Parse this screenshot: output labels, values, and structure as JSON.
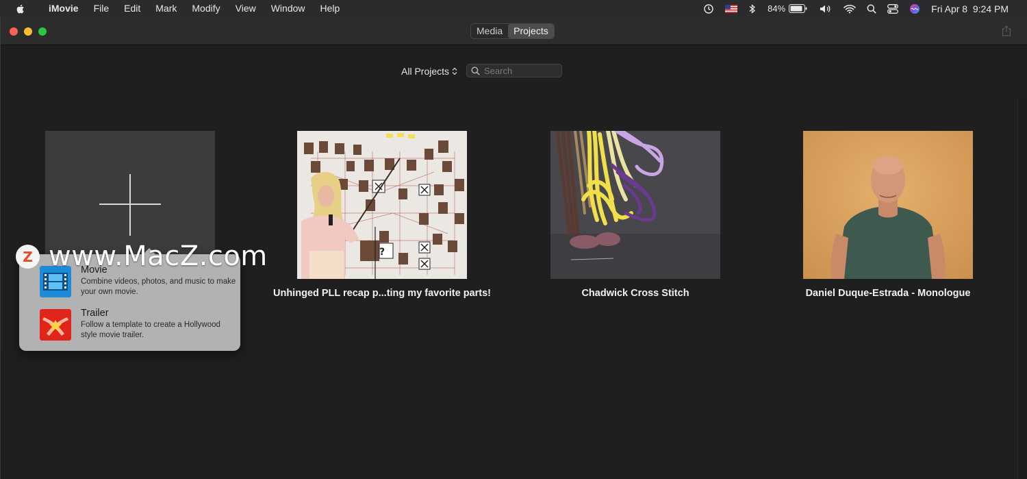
{
  "menubar": {
    "app_name": "iMovie",
    "menus": [
      "File",
      "Edit",
      "Mark",
      "Modify",
      "View",
      "Window",
      "Help"
    ],
    "battery": "84%",
    "datetime": "Fri Apr 8  9:24 PM"
  },
  "toolbar": {
    "tabs": [
      {
        "label": "Media",
        "active": false
      },
      {
        "label": "Projects",
        "active": true
      }
    ]
  },
  "browser": {
    "filter_label": "All Projects",
    "search_placeholder": "Search"
  },
  "projects": [
    {
      "title": "Unhinged PLL recap p...ting my favorite parts!"
    },
    {
      "title": "Chadwick Cross Stitch"
    },
    {
      "title": "Daniel Duque-Estrada - Monologue"
    }
  ],
  "new_project_menu": {
    "options": [
      {
        "title": "Movie",
        "description": "Combine videos, photos, and music to make your own movie."
      },
      {
        "title": "Trailer",
        "description": "Follow a template to create a Hollywood style movie trailer."
      }
    ]
  },
  "watermark": {
    "badge": "Z",
    "text": "www.MacZ.com"
  },
  "colors": {
    "movie_icon": "#1c8cd8",
    "trailer_icon": "#e1251b",
    "popover": "#b2b2b2"
  }
}
